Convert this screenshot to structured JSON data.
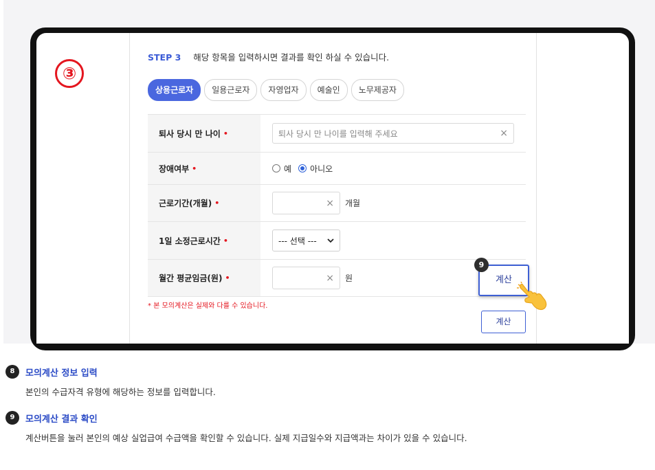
{
  "step": {
    "label": "STEP 3",
    "description": "해당 항목을 입력하시면 결과를 확인 하실 수 있습니다."
  },
  "marker": {
    "number": "③"
  },
  "worker_types": [
    {
      "label": "상용근로자",
      "active": true
    },
    {
      "label": "일용근로자",
      "active": false
    },
    {
      "label": "자영업자",
      "active": false
    },
    {
      "label": "예술인",
      "active": false
    },
    {
      "label": "노무제공자",
      "active": false
    }
  ],
  "form": {
    "age": {
      "label": "퇴사 당시 만 나이",
      "placeholder": "퇴사 당시 만 나이를 입력해 주세요"
    },
    "disability": {
      "label": "장애여부",
      "option_yes": "예",
      "option_no": "아니오",
      "selected": "아니오"
    },
    "period": {
      "label": "근로기간(개월)",
      "unit": "개월"
    },
    "hours": {
      "label": "1일 소정근로시간",
      "selected": "--- 선택 ---"
    },
    "wage": {
      "label": "월간 평균임금(원)",
      "unit": "원"
    },
    "required_mark": "•",
    "clear_mark": "×",
    "note": "* 본 모의계산은 실제와 다를 수 있습니다."
  },
  "buttons": {
    "calc_highlight": "계산",
    "calc": "계산",
    "badge": "9"
  },
  "descriptions": [
    {
      "number": "8",
      "title": "모의계산 정보 입력",
      "text": "본인의 수급자격 유형에 해당하는 정보를 입력합니다."
    },
    {
      "number": "9",
      "title": "모의계산 결과 확인",
      "text": "계산버튼을 눌러 본인의 예상 실업급여 수급액을 확인할 수 있습니다. 실제 지급일수와 지급액과는 차이가 있을 수 있습니다."
    }
  ]
}
